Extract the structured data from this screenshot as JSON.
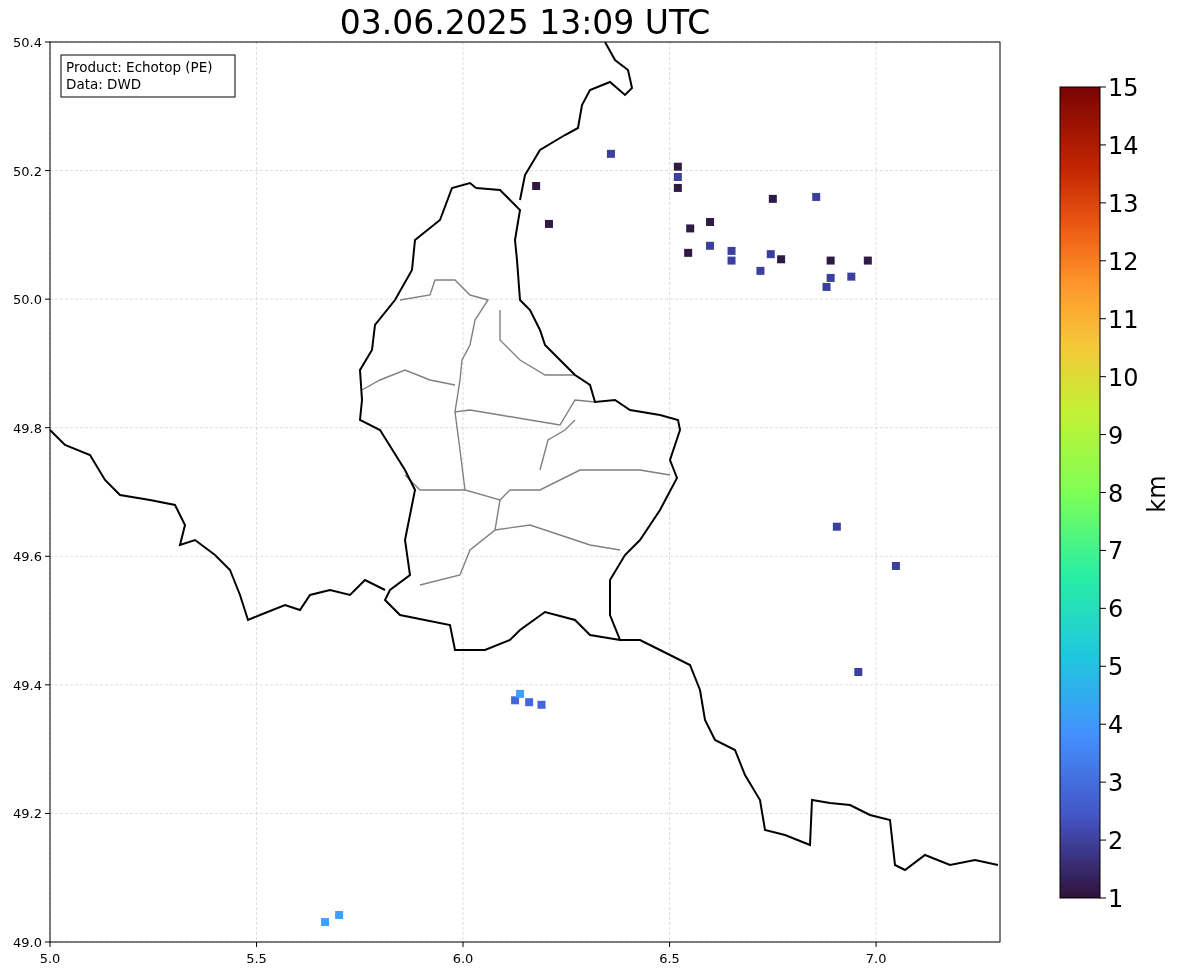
{
  "title": "03.06.2025 13:09 UTC",
  "info_box": [
    "Product: Echotop (PE)",
    "Data: DWD"
  ],
  "map": {
    "chart_data": {
      "type": "scatter",
      "grid": true,
      "xlim": [
        5.0,
        7.3
      ],
      "ylim": [
        49.0,
        50.4
      ],
      "xticks": [
        {
          "value": 5.0,
          "label": "5.0"
        },
        {
          "value": 5.5,
          "label": "5.5"
        },
        {
          "value": 6.0,
          "label": "6.0"
        },
        {
          "value": 6.5,
          "label": "6.5"
        },
        {
          "value": 7.0,
          "label": "7.0"
        }
      ],
      "yticks": [
        {
          "value": 49.0,
          "label": "49.0"
        },
        {
          "value": 49.2,
          "label": "49.2"
        },
        {
          "value": 49.4,
          "label": "49.4"
        },
        {
          "value": 49.6,
          "label": "49.6"
        },
        {
          "value": 49.8,
          "label": "49.8"
        },
        {
          "value": 50.0,
          "label": "50.0"
        },
        {
          "value": 50.2,
          "label": "50.2"
        },
        {
          "value": 50.4,
          "label": "50.4"
        }
      ],
      "series": [
        {
          "color": "#2f1a45",
          "x": [
            6.177,
            6.208,
            6.52,
            6.52,
            6.55,
            6.598,
            6.75,
            6.89,
            6.98,
            6.545,
            6.77
          ],
          "values": [
            50.176,
            50.117,
            50.173,
            50.206,
            50.11,
            50.12,
            50.156,
            50.06,
            50.06,
            50.072,
            50.062
          ]
        },
        {
          "color": "#3b3f9e",
          "x": [
            6.358,
            6.52,
            6.598,
            6.65,
            6.65,
            6.72,
            6.745,
            6.855,
            6.88,
            6.89,
            6.94,
            6.905,
            7.048,
            6.957
          ],
          "values": [
            50.226,
            50.19,
            50.083,
            50.075,
            50.06,
            50.044,
            50.07,
            50.159,
            50.019,
            50.033,
            50.035,
            49.646,
            49.585,
            49.42
          ]
        },
        {
          "color": "#4466dd",
          "x": [
            6.126,
            6.19,
            6.16
          ],
          "values": [
            49.376,
            49.369,
            49.373
          ]
        },
        {
          "color": "#3fa0ff",
          "x": [
            6.138,
            5.666,
            5.7
          ],
          "values": [
            49.386,
            49.031,
            49.042
          ]
        }
      ]
    }
  },
  "colorbar": {
    "label": "km",
    "ticks": [
      "15",
      "14",
      "13",
      "12",
      "11",
      "10",
      "9",
      "8",
      "7",
      "6",
      "5",
      "4",
      "3",
      "2",
      "1"
    ]
  }
}
